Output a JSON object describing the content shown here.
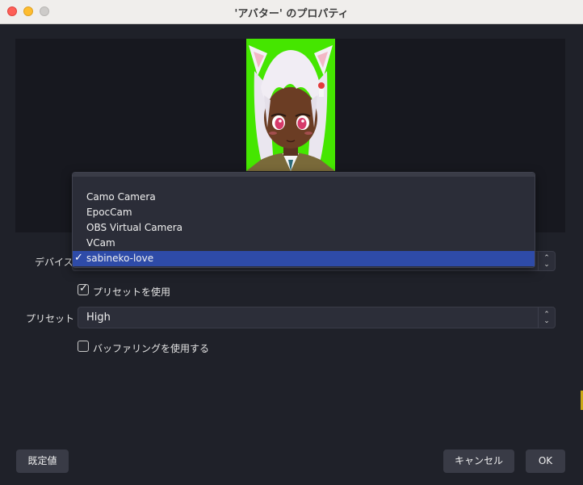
{
  "window": {
    "title": "'アバター' のプロパティ"
  },
  "form": {
    "device_label": "デバイス",
    "device_options": [
      "Camo Camera",
      "EpocCam",
      "OBS Virtual Camera",
      "VCam",
      "sabineko-love"
    ],
    "device_selected": "sabineko-love",
    "use_preset_label": "プリセットを使用",
    "use_preset_checked": true,
    "preset_label": "プリセット",
    "preset_value": "High",
    "buffering_label": "バッファリングを使用する",
    "buffering_checked": false
  },
  "icons": {
    "check": "checkmark-icon",
    "stepper": "up-down-chevron-icon"
  },
  "buttons": {
    "defaults": "既定値",
    "cancel": "キャンセル",
    "ok": "OK"
  },
  "colors": {
    "accent": "#2e4ba8",
    "background": "#1f2129",
    "chroma_green": "#45e600"
  }
}
